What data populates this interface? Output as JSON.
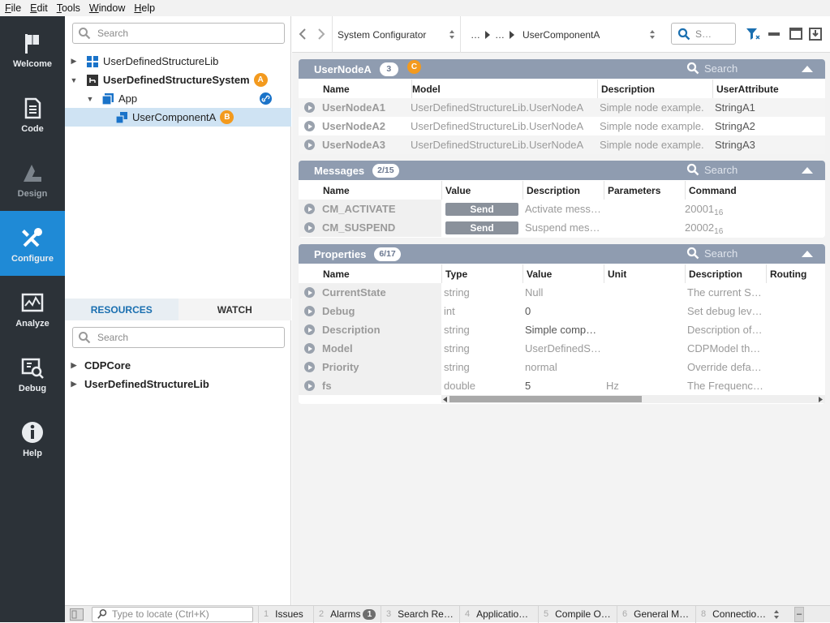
{
  "menu": [
    {
      "pre": "",
      "u": "F",
      "post": "ile"
    },
    {
      "pre": "",
      "u": "E",
      "post": "dit"
    },
    {
      "pre": "",
      "u": "T",
      "post": "ools"
    },
    {
      "pre": "",
      "u": "W",
      "post": "indow"
    },
    {
      "pre": "",
      "u": "H",
      "post": "elp"
    }
  ],
  "nav": {
    "welcome": "Welcome",
    "code": "Code",
    "design": "Design",
    "configure": "Configure",
    "analyze": "Analyze",
    "debug": "Debug",
    "help": "Help"
  },
  "tree": {
    "search_placeholder": "Search",
    "items": [
      {
        "label": "UserDefinedStructureLib"
      },
      {
        "label": "UserDefinedStructureSystem",
        "badge": "A"
      },
      {
        "label": "App"
      },
      {
        "label": "UserComponentA",
        "badge": "B"
      }
    ]
  },
  "bottom": {
    "tab_resources": "RESOURCES",
    "tab_watch": "WATCH",
    "search_placeholder": "Search",
    "items": [
      {
        "label": "CDPCore"
      },
      {
        "label": "UserDefinedStructureLib"
      }
    ]
  },
  "toolbar": {
    "configurator": "System Configurator",
    "ellipsis1": "…",
    "ellipsis2": "…",
    "component": "UserComponentA",
    "search_placeholder": "S…"
  },
  "nodes": {
    "title": "UserNodeA",
    "count": "3",
    "badge": "C",
    "search": "Search",
    "headers": {
      "name": "Name",
      "model": "Model",
      "description": "Description",
      "attr": "UserAttribute"
    },
    "rows": [
      {
        "name": "UserNodeA1",
        "model": "UserDefinedStructureLib.UserNodeA",
        "description": "Simple node example.",
        "attr": "StringA1"
      },
      {
        "name": "UserNodeA2",
        "model": "UserDefinedStructureLib.UserNodeA",
        "description": "Simple node example.",
        "attr": "StringA2"
      },
      {
        "name": "UserNodeA3",
        "model": "UserDefinedStructureLib.UserNodeA",
        "description": "Simple node example.",
        "attr": "StringA3"
      }
    ]
  },
  "messages": {
    "title": "Messages",
    "count": "2/15",
    "search": "Search",
    "headers": {
      "name": "Name",
      "value": "Value",
      "description": "Description",
      "parameters": "Parameters",
      "command": "Command"
    },
    "rows": [
      {
        "name": "CM_ACTIVATE",
        "value": "Send",
        "description": "Activate mess…",
        "parameters": "",
        "command": "20001",
        "sub": "16"
      },
      {
        "name": "CM_SUSPEND",
        "value": "Send",
        "description": "Suspend mes…",
        "parameters": "",
        "command": "20002",
        "sub": "16"
      }
    ]
  },
  "properties": {
    "title": "Properties",
    "count": "6/17",
    "search": "Search",
    "headers": {
      "name": "Name",
      "type": "Type",
      "value": "Value",
      "unit": "Unit",
      "description": "Description",
      "routing": "Routing"
    },
    "rows": [
      {
        "name": "CurrentState",
        "type": "string",
        "value": "Null",
        "unit": "",
        "description": "The current S…"
      },
      {
        "name": "Debug",
        "type": "int",
        "value": "0",
        "unit": "",
        "description": "Set debug lev…"
      },
      {
        "name": "Description",
        "type": "string",
        "value": "Simple comp…",
        "unit": "",
        "description": "Description of…"
      },
      {
        "name": "Model",
        "type": "string",
        "value": "UserDefinedS…",
        "unit": "",
        "description": "CDPModel th…"
      },
      {
        "name": "Priority",
        "type": "string",
        "value": "normal",
        "unit": "",
        "description": "Override defa…"
      },
      {
        "name": "fs",
        "type": "double",
        "value": "5",
        "unit": "Hz",
        "description": "The Frequenc…"
      }
    ]
  },
  "status": {
    "locate_placeholder": "Type to locate (Ctrl+K)",
    "tabs": [
      {
        "num": "1",
        "label": "Issues"
      },
      {
        "num": "2",
        "label": "Alarms",
        "badge": "1"
      },
      {
        "num": "3",
        "label": "Search Re…"
      },
      {
        "num": "4",
        "label": "Applicatio…"
      },
      {
        "num": "5",
        "label": "Compile O…"
      },
      {
        "num": "6",
        "label": "General M…"
      },
      {
        "num": "8",
        "label": "Connectio…"
      }
    ],
    "minus": "–"
  },
  "colors": {
    "accent": "#1f8ad6",
    "badge": "#f39a1e",
    "section_header": "#8f9cb0",
    "nav_bg": "#2c3238"
  }
}
